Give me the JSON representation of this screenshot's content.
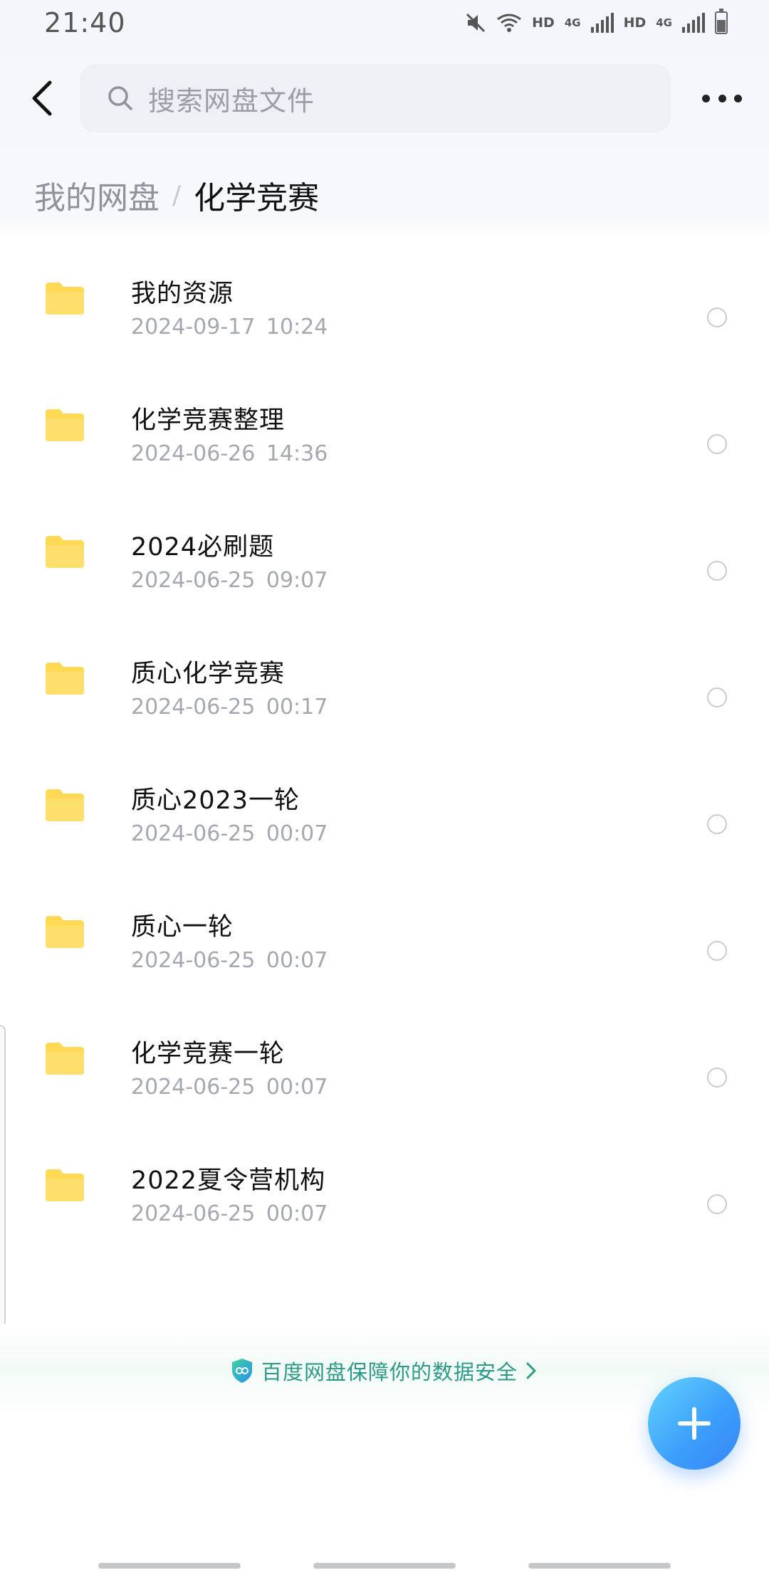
{
  "status_bar": {
    "time": "21:40",
    "hd_1": "HD",
    "net_1": "4G",
    "hd_2": "HD",
    "net_2": "4G",
    "icons": [
      "mute-icon",
      "wifi-icon",
      "signal-icon",
      "battery-icon"
    ]
  },
  "header": {
    "search_placeholder": "搜索网盘文件",
    "back_icon": "chevron-left-icon",
    "more_icon": "more-horizontal-icon"
  },
  "breadcrumb": {
    "root": "我的网盘",
    "separator": "/",
    "current": "化学竞赛"
  },
  "files": [
    {
      "name": "我的资源",
      "date": "2024-09-17  10:24"
    },
    {
      "name": "化学竞赛整理",
      "date": "2024-06-26  14:36"
    },
    {
      "name": "2024必刷题",
      "date": "2024-06-25  09:07"
    },
    {
      "name": "质心化学竞赛",
      "date": "2024-06-25  00:17"
    },
    {
      "name": "质心2023一轮",
      "date": "2024-06-25  00:07"
    },
    {
      "name": "质心一轮",
      "date": "2024-06-25  00:07"
    },
    {
      "name": "化学竞赛一轮",
      "date": "2024-06-25  00:07"
    },
    {
      "name": "2022夏令营机构",
      "date": "2024-06-25  00:07"
    }
  ],
  "footer": {
    "security_text": "百度网盘保障你的数据安全",
    "security_icon": "shield-icon"
  },
  "colors": {
    "folder": "#FFD954",
    "accent": "#3B9DFB",
    "security_text": "#2C9A86"
  }
}
